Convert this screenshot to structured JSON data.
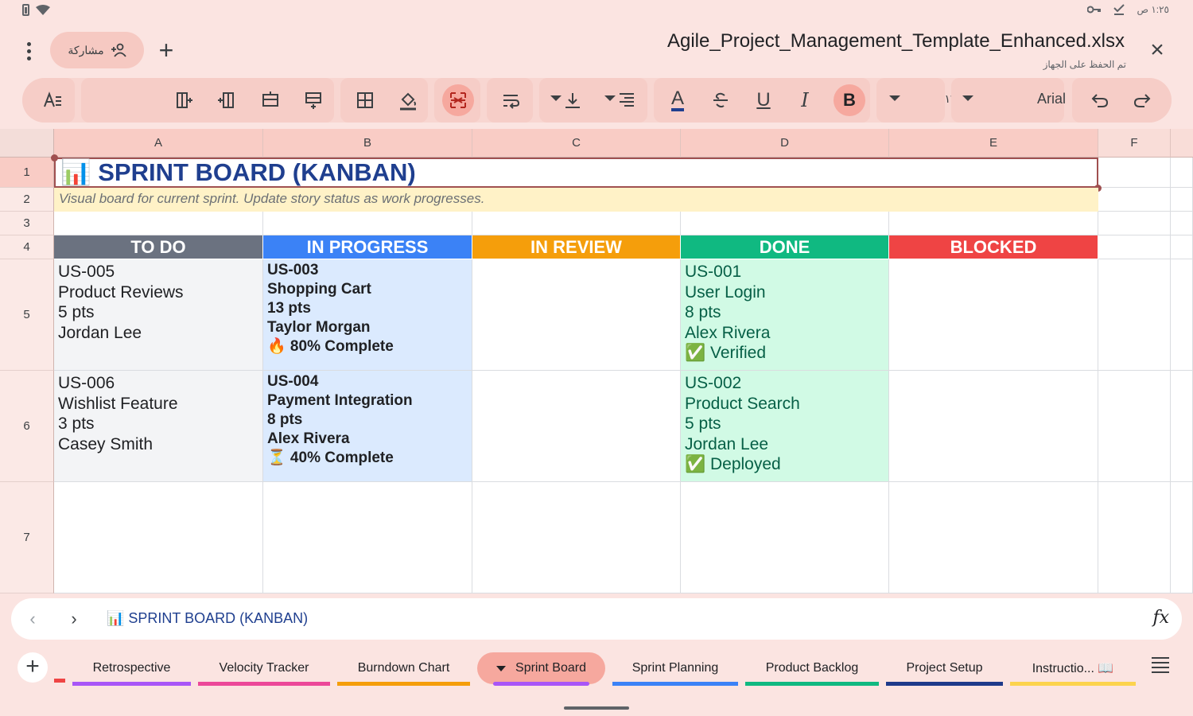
{
  "status_bar": {
    "time": "١:٢٥ ص"
  },
  "header": {
    "share_label": "مشاركة",
    "doc_title": "Agile_Project_Management_Template_Enhanced.xlsx",
    "saved_note": "تم الحفظ على الجهاز"
  },
  "toolbar": {
    "font_name": "Arial",
    "font_size": "١٦",
    "bold_label": "B",
    "italic_label": "I",
    "underline_label": "U",
    "text_color_label": "A"
  },
  "columns": [
    "A",
    "B",
    "C",
    "D",
    "E",
    "F"
  ],
  "rows": [
    "1",
    "2",
    "3",
    "4",
    "5",
    "6",
    "7"
  ],
  "sheet": {
    "title": "📊 SPRINT BOARD (KANBAN)",
    "subtitle": "Visual board for current sprint. Update story status as work progresses.",
    "status_headers": [
      {
        "label": "TO DO",
        "color": "#6b7280"
      },
      {
        "label": "IN PROGRESS",
        "color": "#3b82f6"
      },
      {
        "label": "IN REVIEW",
        "color": "#f59e0b"
      },
      {
        "label": "DONE",
        "color": "#10b981"
      },
      {
        "label": "BLOCKED",
        "color": "#ef4444"
      }
    ],
    "todo": [
      {
        "id": "US-005",
        "name": "Product Reviews",
        "points": "5 pts",
        "owner": "Jordan Lee"
      },
      {
        "id": "US-006",
        "name": "Wishlist Feature",
        "points": "3 pts",
        "owner": "Casey Smith"
      }
    ],
    "in_progress": [
      {
        "id": "US-003",
        "name": "Shopping Cart",
        "points": "13 pts",
        "owner": "Taylor Morgan",
        "status": "🔥 80% Complete"
      },
      {
        "id": "US-004",
        "name": "Payment Integration",
        "points": "8 pts",
        "owner": "Alex Rivera",
        "status": "⏳ 40% Complete"
      }
    ],
    "done": [
      {
        "id": "US-001",
        "name": "User Login",
        "points": "8 pts",
        "owner": "Alex Rivera",
        "status": "✅ Verified"
      },
      {
        "id": "US-002",
        "name": "Product Search",
        "points": "5 pts",
        "owner": "Jordan Lee",
        "status": "✅ Deployed"
      }
    ]
  },
  "formula_bar": {
    "cell_content": "📊 SPRINT BOARD (KANBAN)"
  },
  "tabs": [
    {
      "label": "Retrospective",
      "color": "#a855f7"
    },
    {
      "label": "Velocity Tracker",
      "color": "#ec4899"
    },
    {
      "label": "Burndown Chart",
      "color": "#f59e0b"
    },
    {
      "label": "Sprint Board",
      "color": "#a855f7",
      "active": true
    },
    {
      "label": "Sprint Planning",
      "color": "#3b82f6"
    },
    {
      "label": "Product Backlog",
      "color": "#10b981"
    },
    {
      "label": "Project Setup",
      "color": "#1e3a8a"
    },
    {
      "label": "Instructio... 📖",
      "color": "#fcd34d"
    }
  ],
  "colors": {
    "todo_bg": "#f3f4f6",
    "progress_bg": "#dbeafe",
    "done_bg": "#d1fae5",
    "done_text": "#065f46",
    "accent_tab": "#ef4444"
  }
}
